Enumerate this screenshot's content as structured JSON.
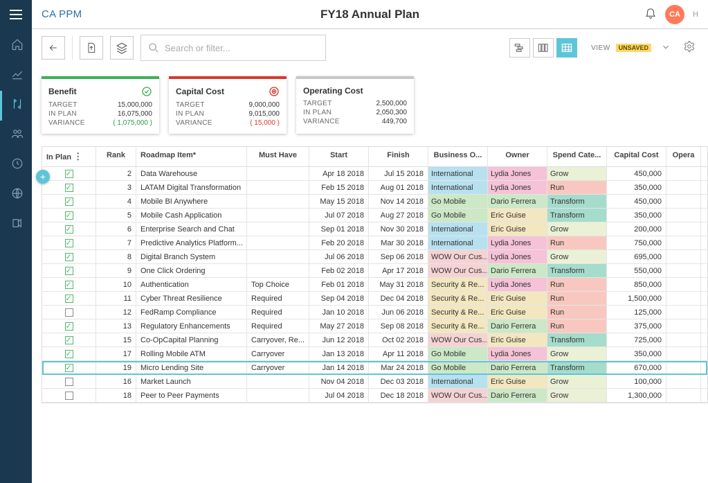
{
  "brand": "CA PPM",
  "page_title": "FY18 Annual Plan",
  "avatar_initials": "CA",
  "hi_label": "H",
  "search_placeholder": "Search or filter...",
  "view_label": "VIEW",
  "unsaved_label": "UNSAVED",
  "cards": [
    {
      "title": "Benefit",
      "stripe": "#3eb156",
      "icon": "target-green",
      "rows": [
        {
          "label": "TARGET",
          "value": "15,000,000"
        },
        {
          "label": "IN PLAN",
          "value": "16,075,000"
        },
        {
          "label": "VARIANCE",
          "value": "( 1,075,000 )",
          "cls": "var-green"
        }
      ]
    },
    {
      "title": "Capital Cost",
      "stripe": "#d63a2e",
      "icon": "target-red",
      "rows": [
        {
          "label": "TARGET",
          "value": "9,000,000"
        },
        {
          "label": "IN PLAN",
          "value": "9,015,000"
        },
        {
          "label": "VARIANCE",
          "value": "( 15,000 )",
          "cls": "var-red"
        }
      ]
    },
    {
      "title": "Operating Cost",
      "stripe": "#c8c8c8",
      "icon": "",
      "rows": [
        {
          "label": "TARGET",
          "value": "2,500,000"
        },
        {
          "label": "IN PLAN",
          "value": "2,050,300"
        },
        {
          "label": "VARIANCE",
          "value": "449,700"
        }
      ]
    }
  ],
  "columns": [
    "In Plan",
    "Rank",
    "Roadmap Item*",
    "Must Have",
    "Start",
    "Finish",
    "Business O...",
    "Owner",
    "Spend Cate...",
    "Capital Cost",
    "Opera"
  ],
  "rows": [
    {
      "in": true,
      "rank": 2,
      "item": "Data Warehouse",
      "must": "",
      "start": "Apr 18 2018",
      "finish": "Jul 15 2018",
      "bu": "International",
      "bu_cls": "c-intl",
      "owner": "Lydia Jones",
      "owner_cls": "c-lydia",
      "spend": "Grow",
      "spend_cls": "c-grow",
      "cc": "450,000"
    },
    {
      "in": true,
      "rank": 3,
      "item": "LATAM Digital Transformation",
      "must": "",
      "start": "Feb 15 2018",
      "finish": "Aug 01 2018",
      "bu": "International",
      "bu_cls": "c-intl",
      "owner": "Lydia Jones",
      "owner_cls": "c-lydia",
      "spend": "Run",
      "spend_cls": "c-run",
      "cc": "350,000"
    },
    {
      "in": true,
      "rank": 4,
      "item": "Mobile BI Anywhere",
      "must": "",
      "start": "May 15 2018",
      "finish": "Nov 14 2018",
      "bu": "Go Mobile",
      "bu_cls": "c-go",
      "owner": "Dario Ferrera",
      "owner_cls": "c-dario",
      "spend": "Transform",
      "spend_cls": "c-trans",
      "cc": "450,000"
    },
    {
      "in": true,
      "rank": 5,
      "item": "Mobile Cash Application",
      "must": "",
      "start": "Jul 07 2018",
      "finish": "Aug 27 2018",
      "bu": "Go Mobile",
      "bu_cls": "c-go",
      "owner": "Eric Guise",
      "owner_cls": "c-eric",
      "spend": "Transform",
      "spend_cls": "c-trans",
      "cc": "350,000"
    },
    {
      "in": true,
      "rank": 6,
      "item": "Enterprise Search and Chat",
      "must": "",
      "start": "Sep 01 2018",
      "finish": "Nov 30 2018",
      "bu": "International",
      "bu_cls": "c-intl",
      "owner": "Eric Guise",
      "owner_cls": "c-eric",
      "spend": "Grow",
      "spend_cls": "c-grow",
      "cc": "200,000"
    },
    {
      "in": true,
      "rank": 7,
      "item": "Predictive Analytics Platform...",
      "must": "",
      "start": "Feb 20 2018",
      "finish": "Mar 30 2018",
      "bu": "International",
      "bu_cls": "c-intl",
      "owner": "Lydia Jones",
      "owner_cls": "c-lydia",
      "spend": "Run",
      "spend_cls": "c-run",
      "cc": "750,000"
    },
    {
      "in": true,
      "rank": 8,
      "item": "Digital Branch System",
      "must": "",
      "start": "Jul 06 2018",
      "finish": "Sep 06 2018",
      "bu": "WOW Our Cus...",
      "bu_cls": "c-wow",
      "owner": "Lydia Jones",
      "owner_cls": "c-lydia",
      "spend": "Grow",
      "spend_cls": "c-grow",
      "cc": "695,000"
    },
    {
      "in": true,
      "rank": 9,
      "item": "One Click Ordering",
      "must": "",
      "start": "Feb 02 2018",
      "finish": "Apr 17 2018",
      "bu": "WOW Our Cus...",
      "bu_cls": "c-wow",
      "owner": "Dario Ferrera",
      "owner_cls": "c-dario",
      "spend": "Transform",
      "spend_cls": "c-trans",
      "cc": "550,000"
    },
    {
      "in": true,
      "rank": 10,
      "item": "Authentication",
      "must": "Top Choice",
      "start": "Feb 01 2018",
      "finish": "May 31 2018",
      "bu": "Security & Re...",
      "bu_cls": "c-sec",
      "owner": "Lydia Jones",
      "owner_cls": "c-lydia",
      "spend": "Run",
      "spend_cls": "c-run",
      "cc": "850,000"
    },
    {
      "in": true,
      "rank": 11,
      "item": "Cyber Threat Resilience",
      "must": "Required",
      "start": "Sep 04 2018",
      "finish": "Dec 04 2018",
      "bu": "Security & Re...",
      "bu_cls": "c-sec",
      "owner": "Eric Guise",
      "owner_cls": "c-eric",
      "spend": "Run",
      "spend_cls": "c-run",
      "cc": "1,500,000"
    },
    {
      "in": false,
      "rank": 12,
      "item": "FedRamp Compliance",
      "must": "Required",
      "start": "Jan 10 2018",
      "finish": "Jun 06 2018",
      "bu": "Security & Re...",
      "bu_cls": "c-sec",
      "owner": "Eric Guise",
      "owner_cls": "c-eric",
      "spend": "Run",
      "spend_cls": "c-run",
      "cc": "125,000"
    },
    {
      "in": true,
      "rank": 13,
      "item": "Regulatory Enhancements",
      "must": "Required",
      "start": "May 27 2018",
      "finish": "Sep 08 2018",
      "bu": "Security & Re...",
      "bu_cls": "c-sec",
      "owner": "Dario Ferrera",
      "owner_cls": "c-dario",
      "spend": "Run",
      "spend_cls": "c-run",
      "cc": "375,000"
    },
    {
      "in": true,
      "rank": 15,
      "item": "Co-OpCapital Planning",
      "must": "Carryover, Re...",
      "start": "Jun 12 2018",
      "finish": "Oct 02 2018",
      "bu": "WOW Our Cus...",
      "bu_cls": "c-wow",
      "owner": "Eric Guise",
      "owner_cls": "c-eric",
      "spend": "Transform",
      "spend_cls": "c-trans",
      "cc": "725,000"
    },
    {
      "in": true,
      "rank": 17,
      "item": "Rolling Mobile ATM",
      "must": "Carryover",
      "start": "Jan 13 2018",
      "finish": "Apr 11 2018",
      "bu": "Go Mobile",
      "bu_cls": "c-go",
      "owner": "Lydia Jones",
      "owner_cls": "c-lydia",
      "spend": "Grow",
      "spend_cls": "c-grow",
      "cc": "350,000"
    },
    {
      "in": true,
      "rank": 19,
      "item": "Micro Lending Site",
      "must": "Carryover",
      "start": "Jan 14 2018",
      "finish": "Mar 24 2018",
      "bu": "Go Mobile",
      "bu_cls": "c-go",
      "owner": "Dario Ferrera",
      "owner_cls": "c-dario",
      "spend": "Transform",
      "spend_cls": "c-trans",
      "cc": "670,000",
      "highlight": true
    },
    {
      "in": false,
      "rank": 16,
      "item": "Market Launch",
      "must": "",
      "start": "Nov 04 2018",
      "finish": "Dec 03 2018",
      "bu": "International",
      "bu_cls": "c-intl",
      "owner": "Eric Guise",
      "owner_cls": "c-eric",
      "spend": "Grow",
      "spend_cls": "c-grow",
      "cc": "100,000"
    },
    {
      "in": false,
      "rank": 18,
      "item": "Peer to Peer Payments",
      "must": "",
      "start": "Jul 04 2018",
      "finish": "Dec 18 2018",
      "bu": "WOW Our Cus...",
      "bu_cls": "c-wow",
      "owner": "Dario Ferrera",
      "owner_cls": "c-dario",
      "spend": "Grow",
      "spend_cls": "c-grow",
      "cc": "1,300,000"
    }
  ]
}
